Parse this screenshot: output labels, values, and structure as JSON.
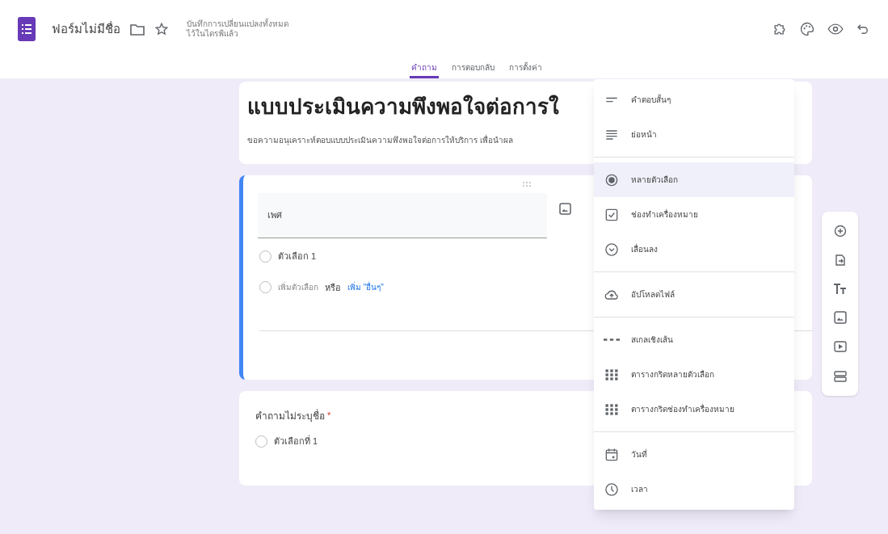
{
  "header": {
    "title": "ฟอร์มไม่มีชื่อ",
    "save_status": [
      "บันทึกการเปลี่ยนแปลงทั้งหมด",
      "ไว้ในไดรฟ์แล้ว"
    ]
  },
  "tabs": [
    {
      "label": "คำถาม",
      "selected": true
    },
    {
      "label": "การตอบกลับ",
      "selected": false
    },
    {
      "label": "การตั้งค่า",
      "selected": false
    }
  ],
  "form_header": {
    "title": "แบบประเมินความพึงพอใจต่อการใ",
    "description": "ขอความอนุเคราะห์ตอบแบบประเมินความพึงพอใจต่อการให้บริการ เพื่อนำผล"
  },
  "active_question": {
    "title": "เพศ",
    "options": [
      {
        "label": "ตัวเลือก 1",
        "checked": false
      }
    ],
    "add_option": "เพิ่มตัวเลือก",
    "or": "หรือ",
    "add_other": "เพิ่ม \"อื่นๆ\""
  },
  "question": {
    "title": "คำถามไม่ระบุชื่อ",
    "required_mark": "*",
    "options": [
      {
        "label": "ตัวเลือกที่ 1",
        "checked": false
      }
    ]
  },
  "type_menu": [
    [
      {
        "kind": "short",
        "label": "คำตอบสั้นๆ",
        "selected": false
      },
      {
        "kind": "paragraph",
        "label": "ย่อหน้า",
        "selected": false
      }
    ],
    [
      {
        "kind": "radio",
        "label": "หลายตัวเลือก",
        "selected": true
      },
      {
        "kind": "checkbox",
        "label": "ช่องทำเครื่องหมาย",
        "selected": false
      },
      {
        "kind": "dropdown",
        "label": "เลื่อนลง",
        "selected": false
      }
    ],
    [
      {
        "kind": "upload",
        "label": "อัปโหลดไฟล์",
        "selected": false
      }
    ],
    [
      {
        "kind": "scale",
        "label": "สเกลเชิงเส้น",
        "selected": false
      },
      {
        "kind": "grid",
        "label": "ตารางกริดหลายตัวเลือก",
        "selected": false
      },
      {
        "kind": "grid",
        "label": "ตารางกริดช่องทำเครื่องหมาย",
        "selected": false
      }
    ],
    [
      {
        "kind": "date",
        "label": "วันที่",
        "selected": false
      },
      {
        "kind": "time",
        "label": "เวลา",
        "selected": false
      }
    ]
  ]
}
